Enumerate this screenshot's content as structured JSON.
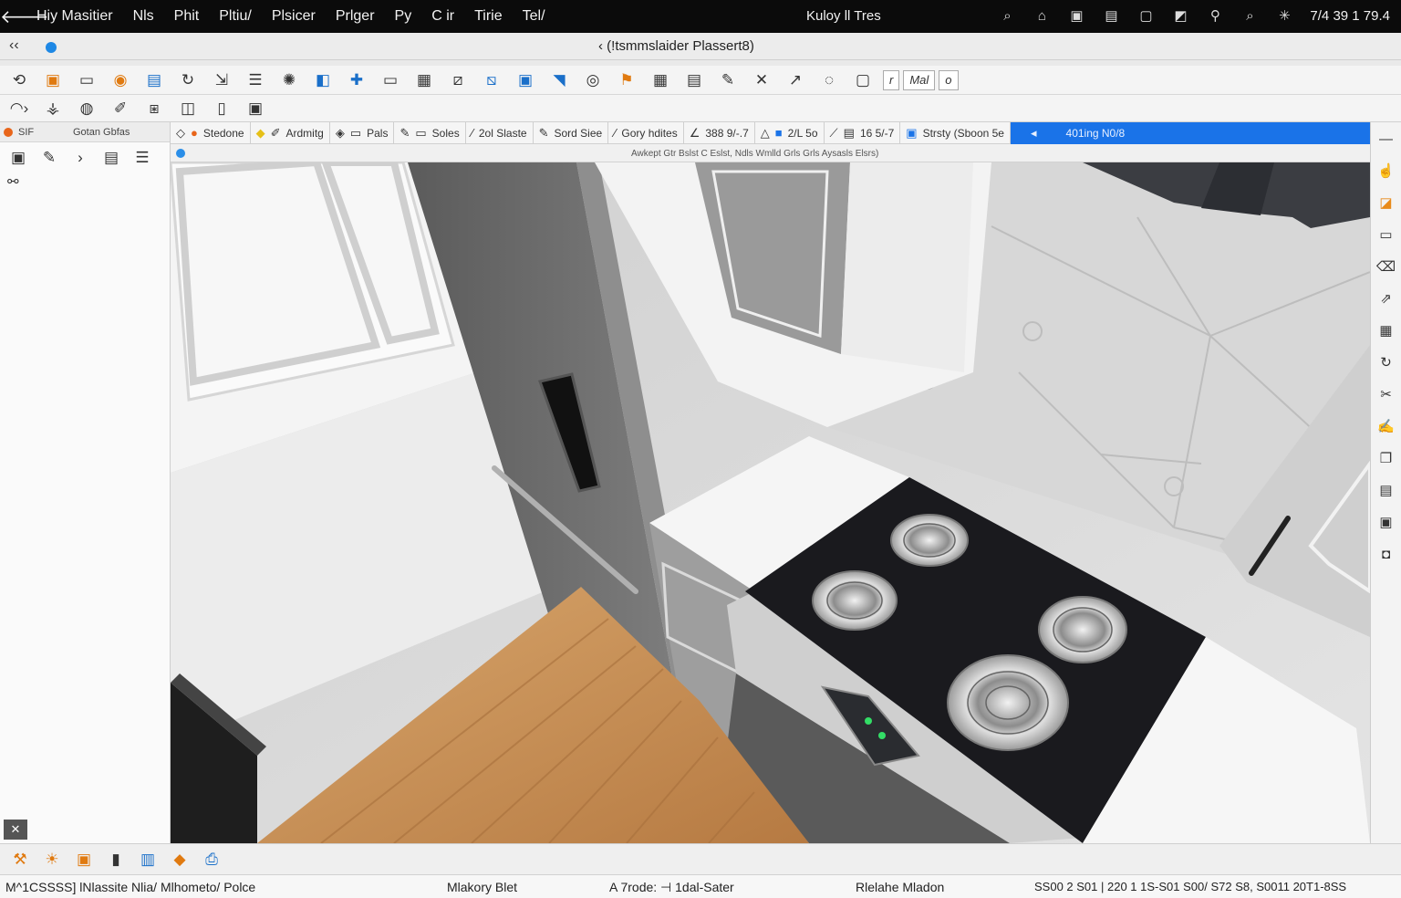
{
  "menubar": {
    "items": [
      "Hiy Masitier",
      "Nls",
      "Phit",
      "Pltiu/",
      "Plsicer",
      "Prlger",
      "Py",
      "C ir",
      "Tirie",
      "Tel/"
    ],
    "center_title": "Kuloy ll Tres",
    "clock": "7/4 39 1 79.4",
    "tray_icons": [
      "search-icon",
      "home-icon",
      "camera-icon",
      "calendar-icon",
      "window-icon",
      "chat-icon",
      "location-icon",
      "magnifier-icon",
      "brightness-icon"
    ]
  },
  "titlebar": {
    "nav": "‹‹",
    "document_title": "‹  (!tsmmslaider Plassert8)"
  },
  "toolbar_main": {
    "mode_labels": [
      "r",
      "Mal",
      "o"
    ]
  },
  "left_panel": {
    "header_left": "SIF",
    "header_right": "Gotan Gbfas"
  },
  "options_bar": {
    "items": [
      "Stedone",
      "Ardmitg",
      "Pals",
      "Soles",
      "2ol Slaste",
      "Sord Siee",
      "Gory hdites",
      "388 9/-.7",
      "2/L 5o",
      "16 5/-7",
      "Strsty (Sboon 5e",
      "401ing N0/8"
    ]
  },
  "hint_bar": {
    "text": "Awkept Gtr Bslst C Eslst, Ndls Wmlld Grls Grls Aysasls Elsrs)"
  },
  "statusbar": {
    "left": "M^1CSSSS] lNlassite Nlia/  Mlhometo/ Polce",
    "tool": "Mlakory Blet",
    "mode": "A 7rode: ⊣ 1dal-Sater",
    "info": "Rlelahe Mladon",
    "coords": "SS00 2 S01 |    220 1 1S-S01 S00/   S72 S8, S0011   20T1-8SS"
  },
  "colors": {
    "menubar_bg": "#0b0b0b",
    "accent_blue": "#1a73e8",
    "accent_orange": "#e8651a",
    "cooktop": "#1a1a1e",
    "floor_wood": "#c9925a"
  }
}
